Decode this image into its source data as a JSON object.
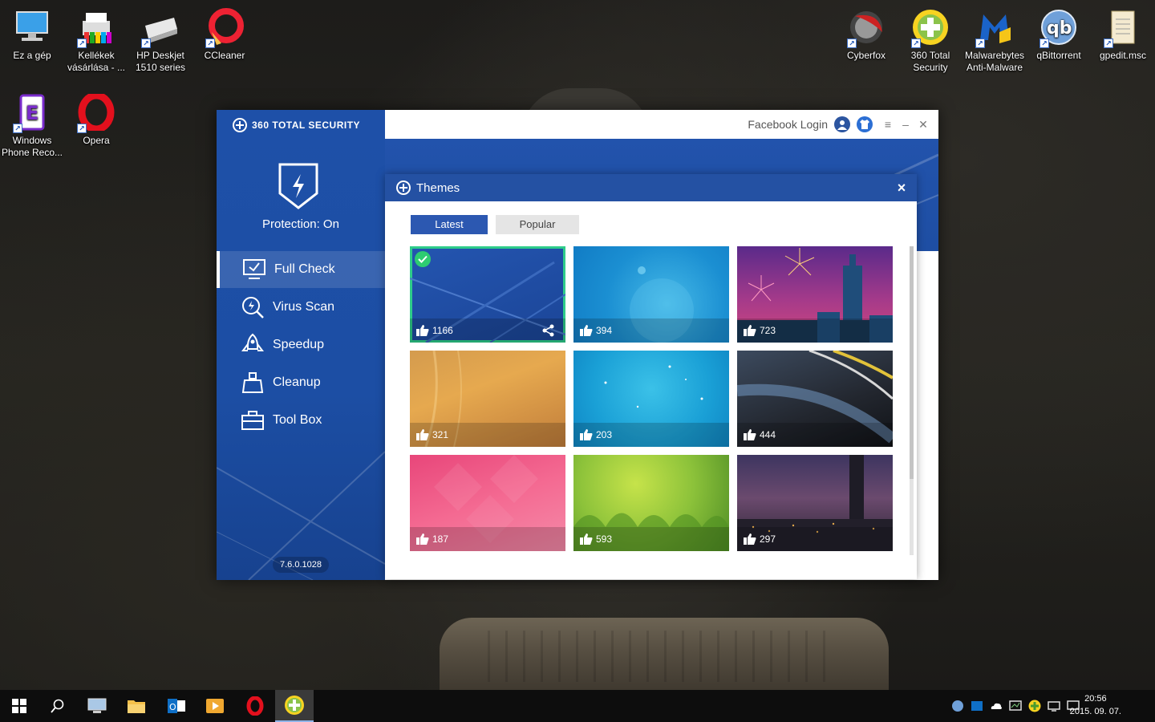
{
  "desktop": {
    "icons_left": [
      {
        "label": "Ez a gép",
        "icon": "computer-icon"
      },
      {
        "label": "Kellékek vásárlása - ...",
        "icon": "printer-supplies-icon"
      },
      {
        "label": "HP Deskjet 1510 series",
        "icon": "printer-icon"
      },
      {
        "label": "CCleaner",
        "icon": "ccleaner-icon"
      },
      {
        "label": "Windows Phone Reco...",
        "icon": "phone-recovery-icon"
      },
      {
        "label": "Opera",
        "icon": "opera-icon"
      }
    ],
    "icons_right": [
      {
        "label": "Cyberfox",
        "icon": "cyberfox-icon"
      },
      {
        "label": "360 Total Security",
        "icon": "360-security-icon"
      },
      {
        "label": "Malwarebytes Anti-Malware",
        "icon": "malwarebytes-icon"
      },
      {
        "label": "qBittorrent",
        "icon": "qbittorrent-icon"
      },
      {
        "label": "gpedit.msc",
        "icon": "document-icon"
      }
    ]
  },
  "app": {
    "brand": "360 TOTAL SECURITY",
    "protection_status": "Protection: On",
    "nav": [
      {
        "label": "Full Check",
        "icon": "monitor-check-icon",
        "active": true
      },
      {
        "label": "Virus Scan",
        "icon": "scan-icon",
        "active": false
      },
      {
        "label": "Speedup",
        "icon": "rocket-icon",
        "active": false
      },
      {
        "label": "Cleanup",
        "icon": "broom-icon",
        "active": false
      },
      {
        "label": "Tool Box",
        "icon": "toolbox-icon",
        "active": false
      }
    ],
    "version": "7.6.0.1028",
    "topbar": {
      "facebook_login": "Facebook Login"
    },
    "accent_color": "#1e50a8"
  },
  "themes_dialog": {
    "title": "Themes",
    "tabs": [
      {
        "label": "Latest",
        "active": true
      },
      {
        "label": "Popular",
        "active": false
      }
    ],
    "themes": [
      {
        "likes": "1166",
        "selected": true,
        "style": "blue-lines"
      },
      {
        "likes": "394",
        "selected": false,
        "style": "sky-bokeh"
      },
      {
        "likes": "723",
        "selected": false,
        "style": "city-fireworks"
      },
      {
        "likes": "321",
        "selected": false,
        "style": "wheat"
      },
      {
        "likes": "203",
        "selected": false,
        "style": "aqua-stars"
      },
      {
        "likes": "444",
        "selected": false,
        "style": "dark-road"
      },
      {
        "likes": "187",
        "selected": false,
        "style": "pink-diamonds"
      },
      {
        "likes": "593",
        "selected": false,
        "style": "green-meadow"
      },
      {
        "likes": "297",
        "selected": false,
        "style": "night-tower"
      }
    ]
  },
  "taskbar": {
    "apps": [
      "start-icon",
      "search-icon",
      "computer-icon",
      "file-explorer-icon",
      "outlook-icon",
      "media-player-icon",
      "opera-icon",
      "360-security-icon"
    ],
    "clock": {
      "time": "20:56",
      "date": "2015. 09. 07."
    }
  }
}
